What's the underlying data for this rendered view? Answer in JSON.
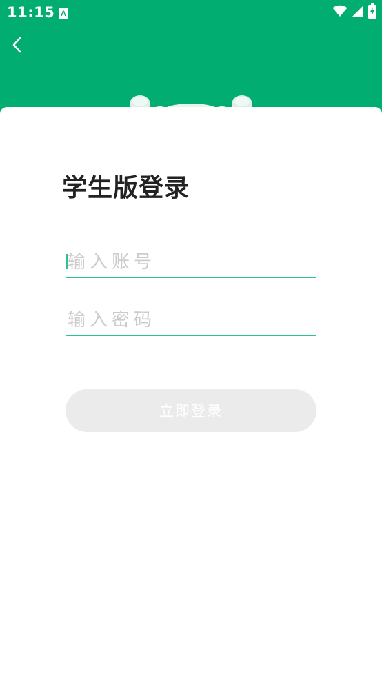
{
  "status_bar": {
    "time": "11:15",
    "notification_icon": "text-a-icon",
    "wifi_icon": "wifi-icon",
    "signal_icon": "signal-icon",
    "battery_icon": "battery-charging-icon"
  },
  "header": {
    "back_icon": "chevron-left-icon",
    "background_color": "#02ad72"
  },
  "login": {
    "title": "学生版登录",
    "account_placeholder": "输入账号",
    "password_placeholder": "输入密码",
    "submit_label": "立即登录"
  },
  "colors": {
    "accent": "#02ad72",
    "field_underline": "#2cc48c",
    "button_disabled_bg": "#ebebeb"
  }
}
